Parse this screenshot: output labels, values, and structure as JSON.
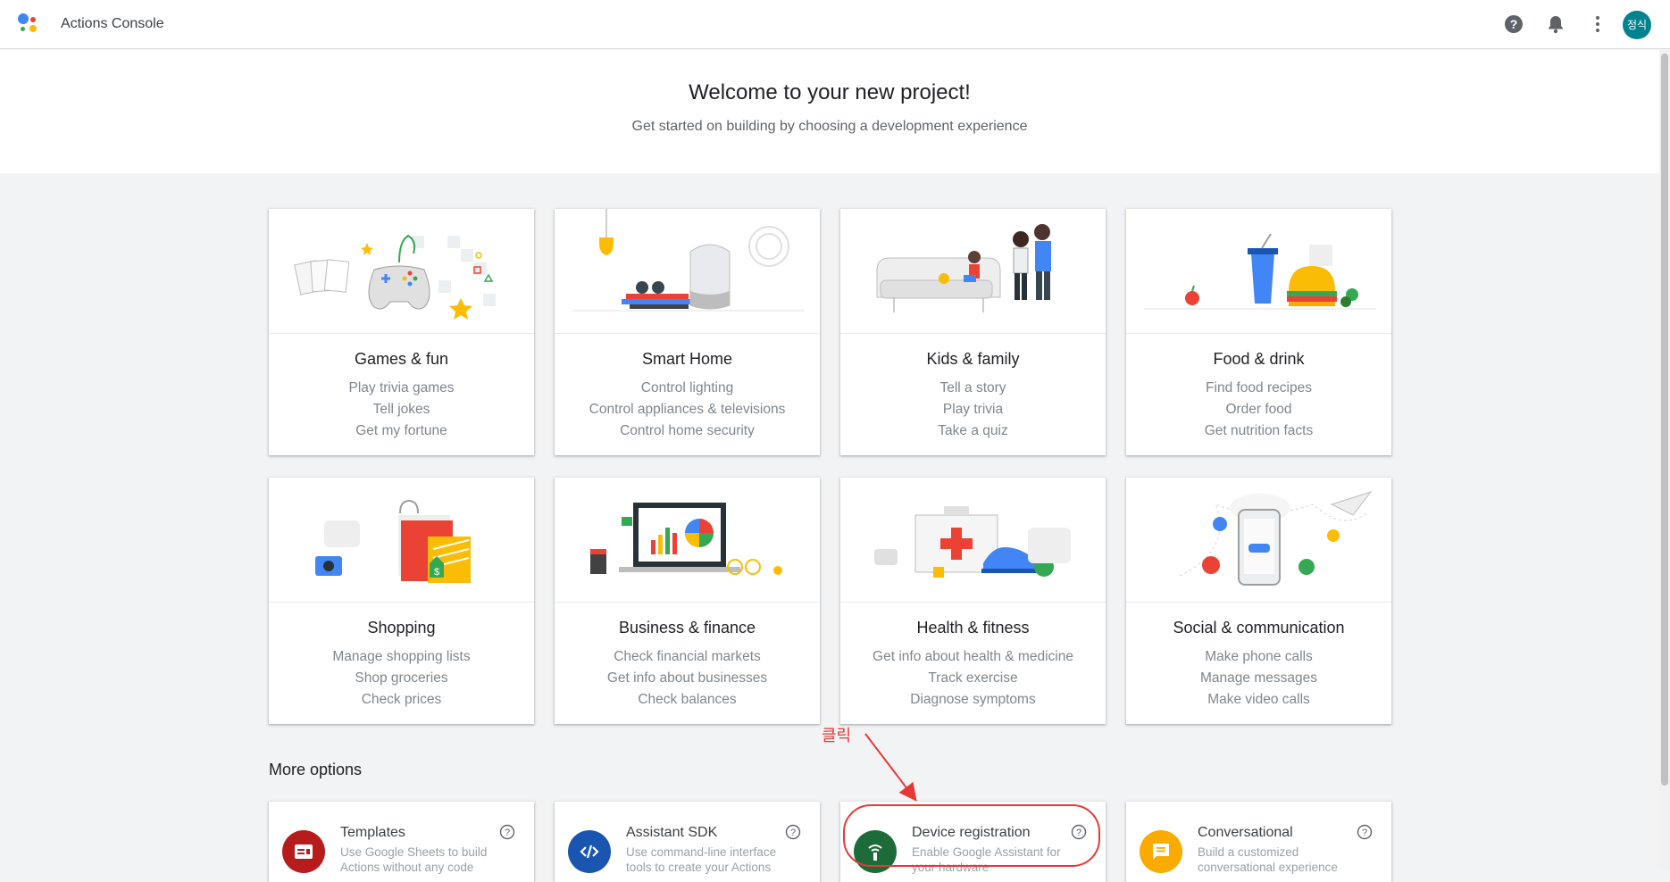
{
  "app": {
    "title": "Actions Console",
    "user_initials": "정식"
  },
  "colors": {
    "accent_red": "#e53935",
    "avatar_teal": "#00838f"
  },
  "welcome": {
    "title": "Welcome to your new project!",
    "subtitle": "Get started on building by choosing a development experience"
  },
  "categories": [
    {
      "title": "Games & fun",
      "lines": [
        "Play trivia games",
        "Tell jokes",
        "Get my fortune"
      ]
    },
    {
      "title": "Smart Home",
      "lines": [
        "Control lighting",
        "Control appliances & televisions",
        "Control home security"
      ]
    },
    {
      "title": "Kids & family",
      "lines": [
        "Tell a story",
        "Play trivia",
        "Take a quiz"
      ]
    },
    {
      "title": "Food & drink",
      "lines": [
        "Find food recipes",
        "Order food",
        "Get nutrition facts"
      ]
    },
    {
      "title": "Shopping",
      "lines": [
        "Manage shopping lists",
        "Shop groceries",
        "Check prices"
      ]
    },
    {
      "title": "Business & finance",
      "lines": [
        "Check financial markets",
        "Get info about businesses",
        "Check balances"
      ]
    },
    {
      "title": "Health & fitness",
      "lines": [
        "Get info about health & medicine",
        "Track exercise",
        "Diagnose symptoms"
      ]
    },
    {
      "title": "Social & communication",
      "lines": [
        "Make phone calls",
        "Manage messages",
        "Make video calls"
      ]
    }
  ],
  "more_options": {
    "title": "More options",
    "items": [
      {
        "title": "Templates",
        "desc1": "Use Google Sheets to build",
        "desc2": "Actions without any code",
        "icon": "templates-icon",
        "color": "#b71c1c"
      },
      {
        "title": "Assistant SDK",
        "desc1": "Use command-line interface",
        "desc2": "tools to create your Actions",
        "icon": "code-icon",
        "color": "#1a56b0"
      },
      {
        "title": "Device registration",
        "desc1": "Enable Google Assistant for",
        "desc2": "your hardware",
        "icon": "device-icon",
        "color": "#1e6b3a"
      },
      {
        "title": "Conversational",
        "desc1": "Build a customized",
        "desc2": "conversational experience",
        "icon": "chat-icon",
        "color": "#f9ab00"
      }
    ]
  },
  "annotation": {
    "text": "클릭"
  }
}
